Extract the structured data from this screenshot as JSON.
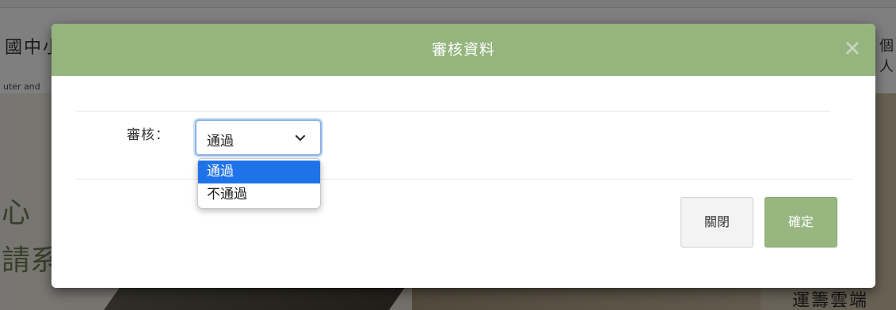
{
  "background": {
    "title_left": "國中小",
    "subtitle_left": "uter and",
    "title_right": "個人",
    "hero_text_1": "心",
    "hero_text_2": "請系",
    "hero_right_text": "運籌雲端"
  },
  "modal": {
    "title": "審核資料",
    "close_symbol": "✕",
    "field": {
      "label": "審核：",
      "selected": "通過",
      "options": [
        "通過",
        "不通過"
      ]
    },
    "buttons": {
      "close_label": "關閉",
      "confirm_label": "確定"
    }
  },
  "colors": {
    "header_bg": "#95b57e",
    "confirm_bg": "#97b680",
    "option_highlight": "#1e73e8"
  }
}
